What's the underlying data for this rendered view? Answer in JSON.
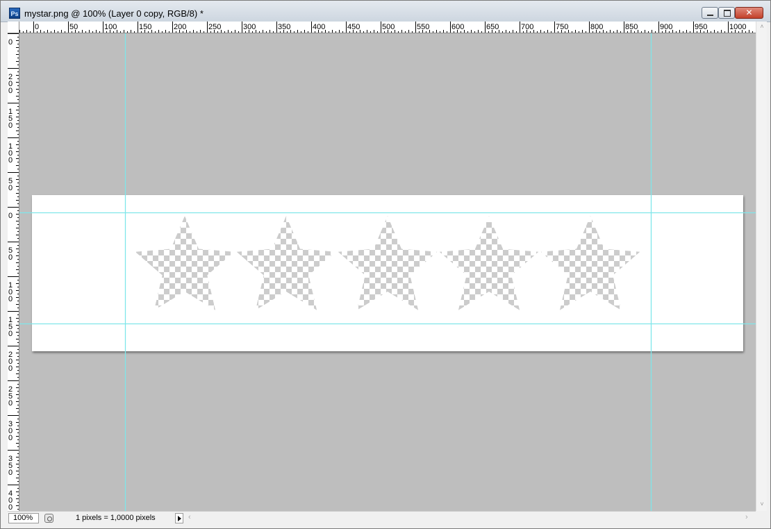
{
  "window": {
    "app_icon_label": "Ps",
    "title": "mystar.png @ 100% (Layer 0 copy, RGB/8) *",
    "buttons": {
      "minimize": "minimize-icon",
      "maximize": "restore-icon",
      "close": "✕"
    }
  },
  "rulers": {
    "horizontal_labels": [
      "0",
      "50",
      "100",
      "150",
      "200",
      "250",
      "300",
      "350",
      "400",
      "450",
      "500",
      "550",
      "600",
      "650",
      "700",
      "750",
      "800",
      "850",
      "900",
      "950",
      "1000"
    ],
    "vertical_labels": [
      [
        "0"
      ],
      [
        "2",
        "0",
        "0"
      ],
      [
        "1",
        "5",
        "0"
      ],
      [
        "1",
        "0",
        "0"
      ],
      [
        "5",
        "0"
      ],
      [
        "0"
      ],
      [
        "5",
        "0"
      ],
      [
        "1",
        "0",
        "0"
      ],
      [
        "1",
        "5",
        "0"
      ],
      [
        "2",
        "0",
        "0"
      ],
      [
        "2",
        "5",
        "0"
      ],
      [
        "3",
        "0",
        "0"
      ],
      [
        "3",
        "5",
        "0"
      ],
      [
        "4",
        "0",
        "0"
      ]
    ]
  },
  "document": {
    "background": "#ffffff",
    "pasteboard": "#bebebe",
    "guide_color": "#7fe6ea",
    "star_count": 5,
    "star_fill": "transparency-checkerboard"
  },
  "status": {
    "zoom": "100%",
    "doc_info": "1 pixels = 1,0000 pixels",
    "scroll_left": "‹",
    "scroll_right": "›"
  },
  "scrollbar": {
    "up": "˄",
    "down": "˅"
  }
}
